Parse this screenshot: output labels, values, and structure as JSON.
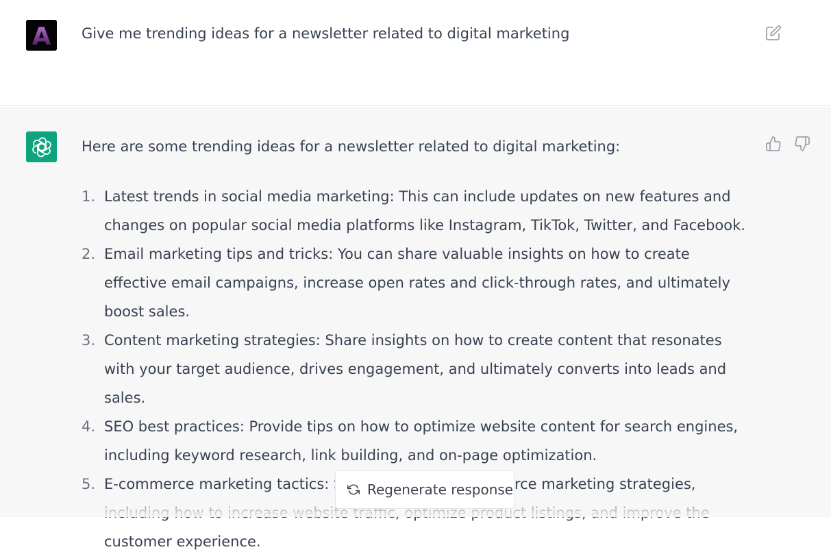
{
  "user": {
    "avatar_letter": "A",
    "message": "Give me trending ideas for a newsletter related to digital marketing",
    "edit_icon": "edit-icon"
  },
  "assistant": {
    "intro": "Here are some trending ideas for a newsletter related to digital marketing:",
    "items": [
      {
        "num": "1.",
        "text": "Latest trends in social media marketing: This can include updates on new features and changes on popular social media platforms like Instagram, TikTok, Twitter, and Facebook."
      },
      {
        "num": "2.",
        "text": "Email marketing tips and tricks: You can share valuable insights on how to create effective email campaigns, increase open rates and click-through rates, and ultimately boost sales."
      },
      {
        "num": "3.",
        "text": "Content marketing strategies: Share insights on how to create content that resonates with your target audience, drives engagement, and ultimately converts into leads and sales."
      },
      {
        "num": "4.",
        "text": "SEO best practices: Provide tips on how to optimize website content for search engines, including keyword research, link building, and on-page optimization."
      },
      {
        "num": "5.",
        "text": "E-commerce marketing tactics: Share effective e-commerce marketing strategies, including how to increase website traffic, optimize product listings, and improve the customer experience."
      }
    ],
    "thumbs_up_icon": "thumbs-up-icon",
    "thumbs_down_icon": "thumbs-down-icon"
  },
  "regenerate": {
    "label": "Regenerate response",
    "icon": "refresh-icon"
  },
  "colors": {
    "assistant_bg": "#f7f7f8",
    "brand": "#10a37f",
    "text": "#374151"
  }
}
